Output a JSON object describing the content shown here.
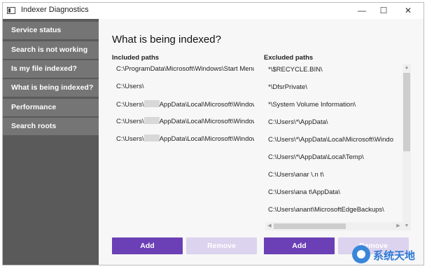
{
  "window": {
    "title": "Indexer Diagnostics"
  },
  "controls": {
    "minimize": "—",
    "maximize": "☐",
    "close": "✕"
  },
  "sidebar": {
    "items": [
      {
        "label": "Service status"
      },
      {
        "label": "Search is not working"
      },
      {
        "label": "Is my file indexed?"
      },
      {
        "label": "What is being indexed?"
      },
      {
        "label": "Performance"
      },
      {
        "label": "Search roots"
      }
    ]
  },
  "main": {
    "title": "What is being indexed?",
    "included": {
      "header": "Included paths",
      "items": [
        {
          "text": "C:\\ProgramData\\Microsoft\\Windows\\Start Menu"
        },
        {
          "text": "C:\\Users\\"
        },
        {
          "pre": "C:\\Users\\",
          "post": "AppData\\Local\\Microsoft\\Window"
        },
        {
          "pre": "C:\\Users\\",
          "post": "AppData\\Local\\Microsoft\\Window"
        },
        {
          "pre": "C:\\Users\\",
          "post": "AppData\\Local\\Microsoft\\Window"
        }
      ],
      "add_label": "Add",
      "remove_label": "Remove"
    },
    "excluded": {
      "header": "Excluded paths",
      "items": [
        "*\\$RECYCLE.BIN\\",
        "*\\DfsrPrivate\\",
        "*\\System Volume Information\\",
        "C:\\Users\\*\\AppData\\",
        "C:\\Users\\*\\AppData\\Local\\Microsoft\\Windo",
        "C:\\Users\\*\\AppData\\Local\\Temp\\",
        "C:\\Users\\anar  \\.n     t\\",
        "C:\\Users\\ana  t\\AppData\\",
        "C:\\Users\\anant\\MicrosoftEdgeBackups\\"
      ],
      "add_label": "Add",
      "remove_label": "Remove"
    }
  },
  "watermark": {
    "text": "系统天地"
  },
  "colors": {
    "accent": "#6b3fb5",
    "sidebar": "#757575",
    "watermark": "#2f7ad6"
  }
}
